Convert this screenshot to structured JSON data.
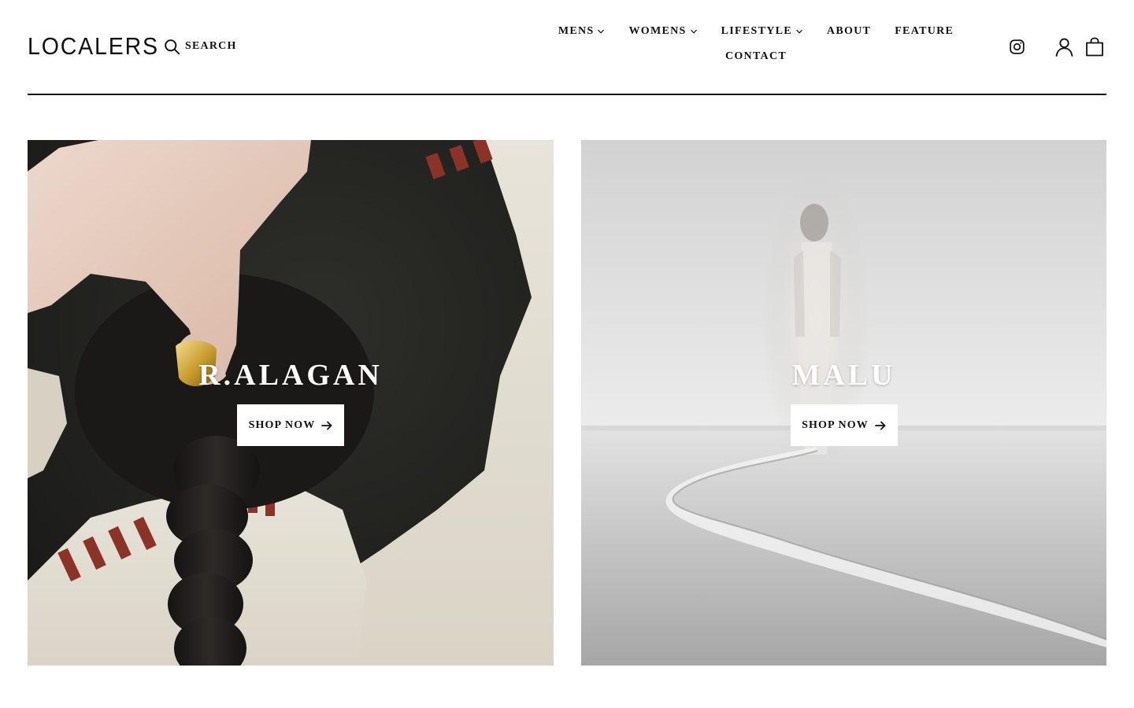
{
  "header": {
    "logo": "LOCALERS",
    "search_label": "SEARCH",
    "nav": [
      {
        "label": "MENS",
        "has_dropdown": true
      },
      {
        "label": "WOMENS",
        "has_dropdown": true
      },
      {
        "label": "LIFESTYLE",
        "has_dropdown": true
      },
      {
        "label": "ABOUT",
        "has_dropdown": false
      },
      {
        "label": "FEATURE",
        "has_dropdown": false
      },
      {
        "label": "CONTACT",
        "has_dropdown": false
      }
    ],
    "icons": [
      "instagram-icon",
      "account-icon",
      "cart-icon"
    ]
  },
  "promos": [
    {
      "title": "R.ALAGAN",
      "button_label": "SHOP NOW",
      "button_icon": "arrow-right-icon"
    },
    {
      "title": "MALU",
      "button_label": "SHOP NOW",
      "button_icon": "arrow-right-icon"
    }
  ],
  "colors": {
    "text": "#111111",
    "background": "#ffffff",
    "divider": "#111111"
  }
}
